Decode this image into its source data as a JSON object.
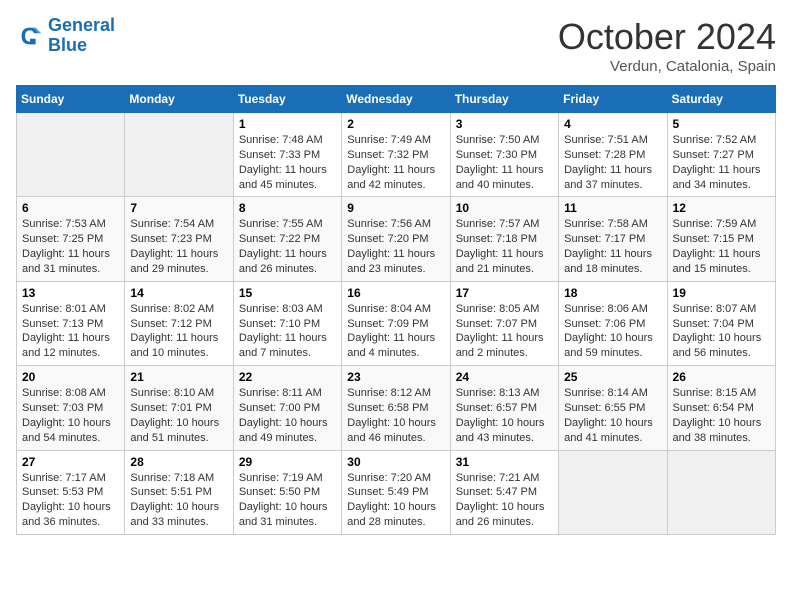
{
  "header": {
    "logo_line1": "General",
    "logo_line2": "Blue",
    "month": "October 2024",
    "location": "Verdun, Catalonia, Spain"
  },
  "weekdays": [
    "Sunday",
    "Monday",
    "Tuesday",
    "Wednesday",
    "Thursday",
    "Friday",
    "Saturday"
  ],
  "weeks": [
    [
      {
        "day": "",
        "info": ""
      },
      {
        "day": "",
        "info": ""
      },
      {
        "day": "1",
        "info": "Sunrise: 7:48 AM\nSunset: 7:33 PM\nDaylight: 11 hours and 45 minutes."
      },
      {
        "day": "2",
        "info": "Sunrise: 7:49 AM\nSunset: 7:32 PM\nDaylight: 11 hours and 42 minutes."
      },
      {
        "day": "3",
        "info": "Sunrise: 7:50 AM\nSunset: 7:30 PM\nDaylight: 11 hours and 40 minutes."
      },
      {
        "day": "4",
        "info": "Sunrise: 7:51 AM\nSunset: 7:28 PM\nDaylight: 11 hours and 37 minutes."
      },
      {
        "day": "5",
        "info": "Sunrise: 7:52 AM\nSunset: 7:27 PM\nDaylight: 11 hours and 34 minutes."
      }
    ],
    [
      {
        "day": "6",
        "info": "Sunrise: 7:53 AM\nSunset: 7:25 PM\nDaylight: 11 hours and 31 minutes."
      },
      {
        "day": "7",
        "info": "Sunrise: 7:54 AM\nSunset: 7:23 PM\nDaylight: 11 hours and 29 minutes."
      },
      {
        "day": "8",
        "info": "Sunrise: 7:55 AM\nSunset: 7:22 PM\nDaylight: 11 hours and 26 minutes."
      },
      {
        "day": "9",
        "info": "Sunrise: 7:56 AM\nSunset: 7:20 PM\nDaylight: 11 hours and 23 minutes."
      },
      {
        "day": "10",
        "info": "Sunrise: 7:57 AM\nSunset: 7:18 PM\nDaylight: 11 hours and 21 minutes."
      },
      {
        "day": "11",
        "info": "Sunrise: 7:58 AM\nSunset: 7:17 PM\nDaylight: 11 hours and 18 minutes."
      },
      {
        "day": "12",
        "info": "Sunrise: 7:59 AM\nSunset: 7:15 PM\nDaylight: 11 hours and 15 minutes."
      }
    ],
    [
      {
        "day": "13",
        "info": "Sunrise: 8:01 AM\nSunset: 7:13 PM\nDaylight: 11 hours and 12 minutes."
      },
      {
        "day": "14",
        "info": "Sunrise: 8:02 AM\nSunset: 7:12 PM\nDaylight: 11 hours and 10 minutes."
      },
      {
        "day": "15",
        "info": "Sunrise: 8:03 AM\nSunset: 7:10 PM\nDaylight: 11 hours and 7 minutes."
      },
      {
        "day": "16",
        "info": "Sunrise: 8:04 AM\nSunset: 7:09 PM\nDaylight: 11 hours and 4 minutes."
      },
      {
        "day": "17",
        "info": "Sunrise: 8:05 AM\nSunset: 7:07 PM\nDaylight: 11 hours and 2 minutes."
      },
      {
        "day": "18",
        "info": "Sunrise: 8:06 AM\nSunset: 7:06 PM\nDaylight: 10 hours and 59 minutes."
      },
      {
        "day": "19",
        "info": "Sunrise: 8:07 AM\nSunset: 7:04 PM\nDaylight: 10 hours and 56 minutes."
      }
    ],
    [
      {
        "day": "20",
        "info": "Sunrise: 8:08 AM\nSunset: 7:03 PM\nDaylight: 10 hours and 54 minutes."
      },
      {
        "day": "21",
        "info": "Sunrise: 8:10 AM\nSunset: 7:01 PM\nDaylight: 10 hours and 51 minutes."
      },
      {
        "day": "22",
        "info": "Sunrise: 8:11 AM\nSunset: 7:00 PM\nDaylight: 10 hours and 49 minutes."
      },
      {
        "day": "23",
        "info": "Sunrise: 8:12 AM\nSunset: 6:58 PM\nDaylight: 10 hours and 46 minutes."
      },
      {
        "day": "24",
        "info": "Sunrise: 8:13 AM\nSunset: 6:57 PM\nDaylight: 10 hours and 43 minutes."
      },
      {
        "day": "25",
        "info": "Sunrise: 8:14 AM\nSunset: 6:55 PM\nDaylight: 10 hours and 41 minutes."
      },
      {
        "day": "26",
        "info": "Sunrise: 8:15 AM\nSunset: 6:54 PM\nDaylight: 10 hours and 38 minutes."
      }
    ],
    [
      {
        "day": "27",
        "info": "Sunrise: 7:17 AM\nSunset: 5:53 PM\nDaylight: 10 hours and 36 minutes."
      },
      {
        "day": "28",
        "info": "Sunrise: 7:18 AM\nSunset: 5:51 PM\nDaylight: 10 hours and 33 minutes."
      },
      {
        "day": "29",
        "info": "Sunrise: 7:19 AM\nSunset: 5:50 PM\nDaylight: 10 hours and 31 minutes."
      },
      {
        "day": "30",
        "info": "Sunrise: 7:20 AM\nSunset: 5:49 PM\nDaylight: 10 hours and 28 minutes."
      },
      {
        "day": "31",
        "info": "Sunrise: 7:21 AM\nSunset: 5:47 PM\nDaylight: 10 hours and 26 minutes."
      },
      {
        "day": "",
        "info": ""
      },
      {
        "day": "",
        "info": ""
      }
    ]
  ]
}
